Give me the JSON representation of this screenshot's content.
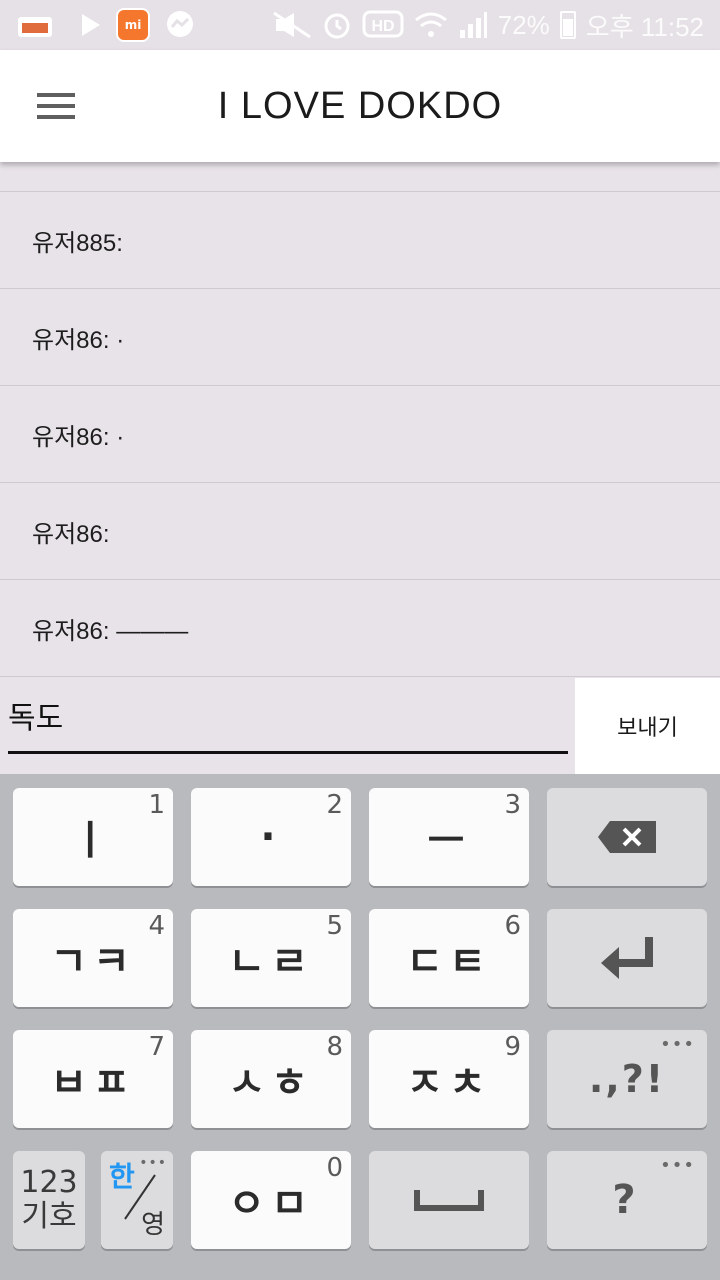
{
  "status_bar": {
    "battery_percent": "72%",
    "time": "오후 11:52",
    "icons": [
      "folder-icon",
      "play-icon",
      "mi-icon",
      "messenger-icon",
      "mute-icon",
      "alarm-icon",
      "hd-icon",
      "wifi-icon",
      "signal-icon",
      "battery-icon"
    ],
    "mi_label": "mi"
  },
  "app_bar": {
    "title": "I LOVE DOKDO",
    "menu_icon": "hamburger-menu-icon"
  },
  "messages": [
    {
      "text": "유저885:"
    },
    {
      "text": "유저86: ·"
    },
    {
      "text": "유저86: ·"
    },
    {
      "text": "유저86:"
    },
    {
      "text": "유저86: ———"
    }
  ],
  "composer": {
    "input_value": "독도",
    "send_label": "보내기"
  },
  "keyboard": {
    "row1": [
      {
        "label": "ㅣ",
        "num": "1"
      },
      {
        "label": "·",
        "num": "2"
      },
      {
        "label": "ㅡ",
        "num": "3"
      }
    ],
    "row2": [
      {
        "label": "ㄱㅋ",
        "num": "4"
      },
      {
        "label": "ㄴㄹ",
        "num": "5"
      },
      {
        "label": "ㄷㅌ",
        "num": "6"
      }
    ],
    "row3": [
      {
        "label": "ㅂㅍ",
        "num": "7"
      },
      {
        "label": "ㅅㅎ",
        "num": "8"
      },
      {
        "label": "ㅈㅊ",
        "num": "9"
      }
    ],
    "row4": [
      {
        "label": "ㅇㅁ",
        "num": "0"
      }
    ],
    "punct_label": ".,?!",
    "question_label": "?",
    "num_mode_top": "123",
    "num_mode_bottom": "기호",
    "lang_han": "한",
    "lang_yeong": "영",
    "more_dots": "•••",
    "lang_color": "#2196f3"
  }
}
